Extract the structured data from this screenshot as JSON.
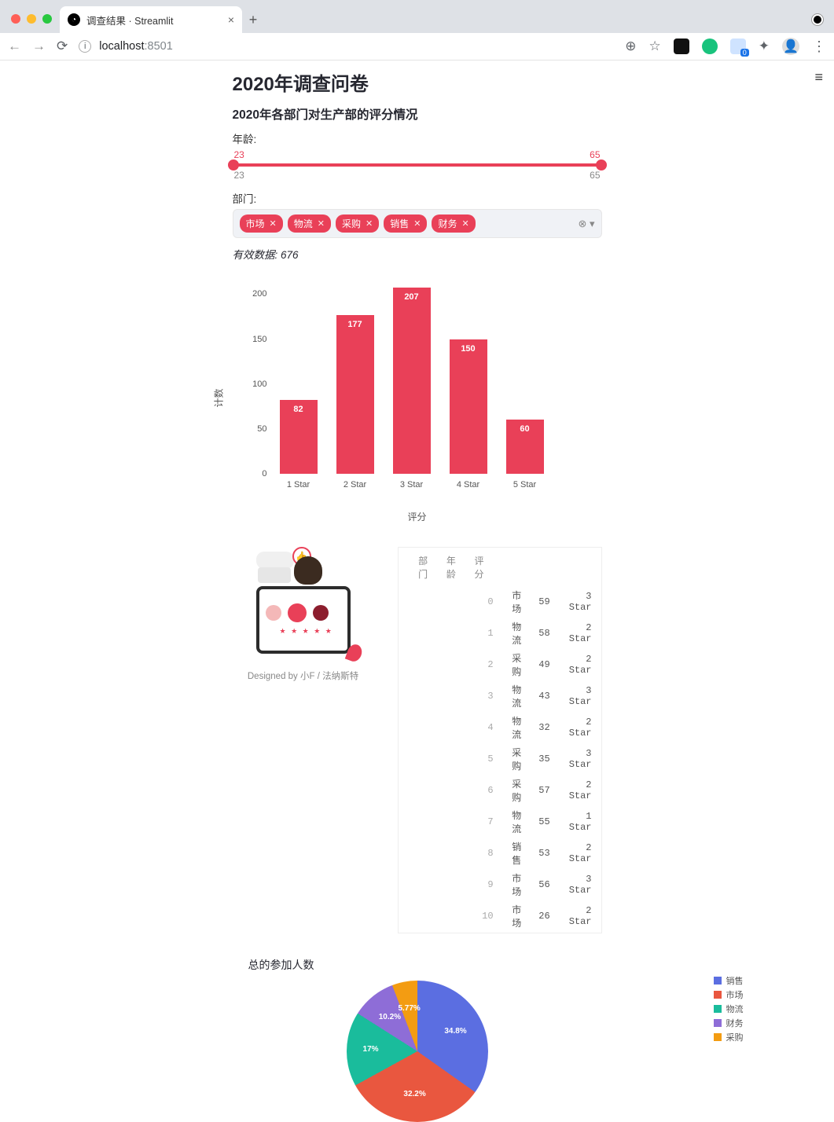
{
  "browser": {
    "tab_title": "调查结果 · Streamlit",
    "url_host": "localhost",
    "url_port": ":8501"
  },
  "page": {
    "title": "2020年调查问卷",
    "subtitle": "2020年各部门对生产部的评分情况",
    "age_label": "年龄:",
    "age_min": "23",
    "age_max": "65",
    "dept_label": "部门:",
    "chips": [
      "市场",
      "物流",
      "采购",
      "销售",
      "财务"
    ],
    "valid_label": "有效数据: 676",
    "image_caption": "Designed by 小F / 法纳斯特",
    "pie_title": "总的参加人数"
  },
  "chart_data": {
    "type": "bar",
    "categories": [
      "1 Star",
      "2 Star",
      "3 Star",
      "4 Star",
      "5 Star"
    ],
    "values": [
      82,
      177,
      207,
      150,
      60
    ],
    "xlabel": "评分",
    "ylabel": "计数",
    "ylim": [
      0,
      210
    ],
    "yticks": [
      0,
      50,
      100,
      150,
      200
    ]
  },
  "table": {
    "columns": [
      "部门",
      "年龄",
      "评分"
    ],
    "rows": [
      {
        "i": "0",
        "dept": "市场",
        "age": "59",
        "rating": "3 Star"
      },
      {
        "i": "1",
        "dept": "物流",
        "age": "58",
        "rating": "2 Star"
      },
      {
        "i": "2",
        "dept": "采购",
        "age": "49",
        "rating": "2 Star"
      },
      {
        "i": "3",
        "dept": "物流",
        "age": "43",
        "rating": "3 Star"
      },
      {
        "i": "4",
        "dept": "物流",
        "age": "32",
        "rating": "2 Star"
      },
      {
        "i": "5",
        "dept": "采购",
        "age": "35",
        "rating": "3 Star"
      },
      {
        "i": "6",
        "dept": "采购",
        "age": "57",
        "rating": "2 Star"
      },
      {
        "i": "7",
        "dept": "物流",
        "age": "55",
        "rating": "1 Star"
      },
      {
        "i": "8",
        "dept": "销售",
        "age": "53",
        "rating": "2 Star"
      },
      {
        "i": "9",
        "dept": "市场",
        "age": "56",
        "rating": "3 Star"
      },
      {
        "i": "10",
        "dept": "市场",
        "age": "26",
        "rating": "2 Star"
      }
    ]
  },
  "pie": {
    "type": "pie",
    "series": [
      {
        "name": "销售",
        "pct": 34.8,
        "color": "#5b6ee1"
      },
      {
        "name": "市场",
        "pct": 32.2,
        "color": "#e9573f"
      },
      {
        "name": "物流",
        "pct": 17.0,
        "color": "#1abc9c"
      },
      {
        "name": "财务",
        "pct": 10.2,
        "color": "#8e6dd7"
      },
      {
        "name": "采购",
        "pct": 5.77,
        "color": "#f39c12"
      }
    ]
  }
}
